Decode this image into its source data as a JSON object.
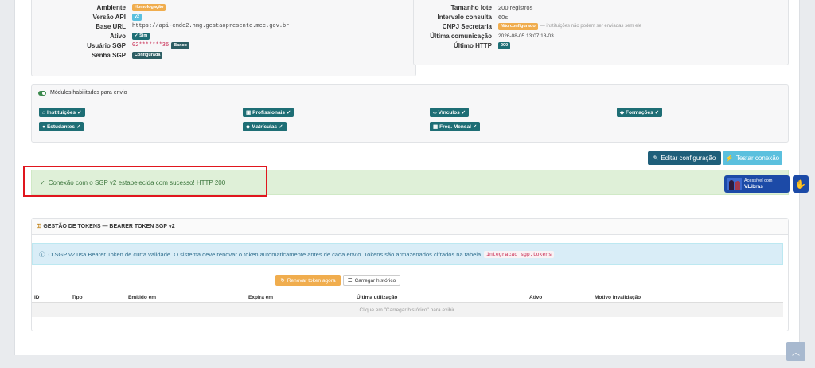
{
  "config_left": {
    "ambiente_label": "Ambiente",
    "ambiente_value": "Homologação",
    "versao_label": "Versão API",
    "versao_value": "v2",
    "base_url_label": "Base URL",
    "base_url_value": "https://api-cmde2.hmg.gestaopresente.mec.gov.br",
    "ativo_label": "Ativo",
    "ativo_value": "Sim",
    "usuario_label": "Usuário SGP",
    "usuario_value": "02*******36",
    "usuario_badge": "Banco",
    "senha_label": "Senha SGP",
    "senha_value": "Configurada"
  },
  "config_right": {
    "tamanho_label": "Tamanho lote",
    "tamanho_value": "200 registros",
    "intervalo_label": "Intervalo consulta",
    "intervalo_value": "60s",
    "cnpj_label": "CNPJ Secretaria",
    "cnpj_badge": "Não configurado",
    "cnpj_note": "— instituições não podem ser enviadas sem ele",
    "ultima_label": "Última comunicação",
    "ultima_value": "2026-08-05 13:07:18-03",
    "http_label": "Último HTTP",
    "http_value": "200"
  },
  "modules": {
    "title": "Módulos habilitados para envio",
    "items": [
      {
        "icon": "bank-icon",
        "glyph": "⌂",
        "label": "Instituições"
      },
      {
        "icon": "briefcase-icon",
        "glyph": "▣",
        "label": "Profissionais"
      },
      {
        "icon": "link-icon",
        "glyph": "∞",
        "label": "Vínculos"
      },
      {
        "icon": "graduation-cap-icon",
        "glyph": "◆",
        "label": "Formações"
      },
      {
        "icon": "user-icon",
        "glyph": "●",
        "label": "Estudantes"
      },
      {
        "icon": "graduation-cap-icon",
        "glyph": "◆",
        "label": "Matrículas"
      },
      {
        "icon": "calendar-icon",
        "glyph": "▦",
        "label": "Freq. Mensal"
      }
    ]
  },
  "actions": {
    "edit_label": "Editar configuração",
    "test_label": "Testar conexão"
  },
  "alert": {
    "message": "Conexão com o SGP v2 estabelecida com sucesso! HTTP 200"
  },
  "vlibras": {
    "line1": "Acessível com",
    "line2": "VLibras"
  },
  "tokens": {
    "title": "GESTÃO DE TOKENS — BEARER TOKEN SGP v2",
    "info_text": "O SGP v2 usa Bearer Token de curta validade. O sistema deve renovar o token automaticamente antes de cada envio. Tokens são armazenados cifrados na tabela",
    "info_code": "integracao_sgp.tokens",
    "info_end": ".",
    "renew_label": "Renovar token agora",
    "history_label": "Carregar histórico",
    "columns": [
      "ID",
      "Tipo",
      "Emitido em",
      "Expira em",
      "Última utilização",
      "Ativo",
      "Motivo invalidação"
    ],
    "empty_text": "Clique em \"Carregar histórico\" para exibir."
  }
}
